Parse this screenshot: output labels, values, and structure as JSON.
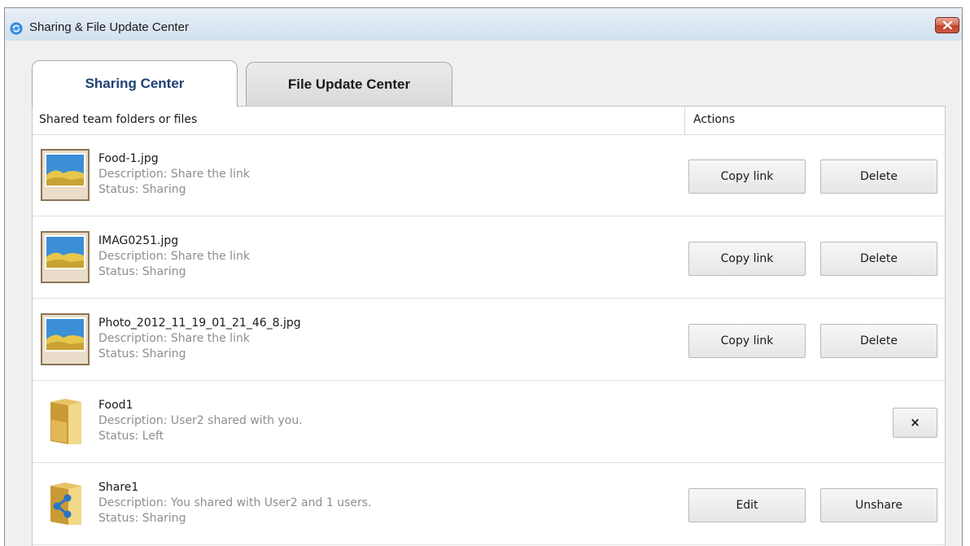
{
  "window": {
    "title": "Sharing & File Update Center"
  },
  "tabs": {
    "active_label": "Sharing Center",
    "inactive_label": "File Update Center"
  },
  "table": {
    "col_files": "Shared team folders or files",
    "col_actions": "Actions"
  },
  "rows": [
    {
      "icon": "image-file-icon",
      "name": "Food-1.jpg",
      "description": "Description: Share the link",
      "status": "Status: Sharing",
      "action1": "Copy link",
      "action2": "Delete"
    },
    {
      "icon": "image-file-icon",
      "name": "IMAG0251.jpg",
      "description": "Description: Share the link",
      "status": "Status: Sharing",
      "action1": "Copy link",
      "action2": "Delete"
    },
    {
      "icon": "image-file-icon",
      "name": "Photo_2012_11_19_01_21_46_8.jpg",
      "description": "Description: Share the link",
      "status": "Status: Sharing",
      "action1": "Copy link",
      "action2": "Delete"
    },
    {
      "icon": "folder-icon",
      "name": "Food1",
      "description": "Description: User2 shared with you.",
      "status": "Status: Left",
      "remove_label": "×"
    },
    {
      "icon": "shared-folder-icon",
      "name": "Share1",
      "description": "Description: You shared with User2 and 1 users.",
      "status": "Status: Sharing",
      "action1": "Edit",
      "action2": "Unshare"
    }
  ],
  "colors": {
    "active_tab_text": "#1f3f72",
    "title_bar": "#dde8f3",
    "close_button": "#c2402a",
    "secondary_text": "#8e8e8e"
  }
}
